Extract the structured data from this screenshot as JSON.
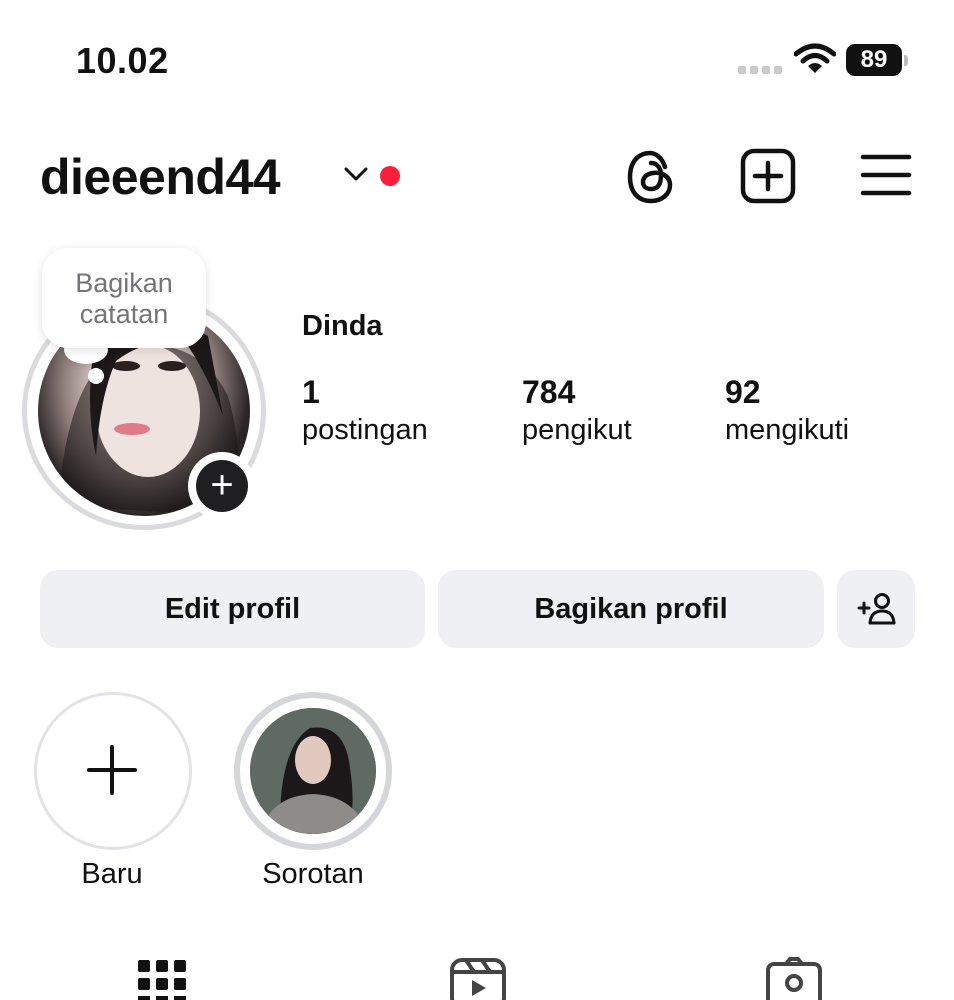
{
  "status_bar": {
    "time": "10.02",
    "battery": "89"
  },
  "header": {
    "username": "dieeend44",
    "icons": [
      "chevron-down-icon",
      "notification-dot",
      "threads-icon",
      "add-post-icon",
      "menu-icon"
    ]
  },
  "profile": {
    "note_text_line1": "Bagikan",
    "note_text_line2": "catatan",
    "display_name": "Dinda",
    "stats": [
      {
        "value": "1",
        "label": "postingan"
      },
      {
        "value": "784",
        "label": "pengikut"
      },
      {
        "value": "92",
        "label": "mengikuti"
      }
    ]
  },
  "actions": {
    "edit_label": "Edit profil",
    "share_label": "Bagikan profil",
    "add_person_icon": "add-person-icon"
  },
  "highlights": [
    {
      "label": "Baru"
    },
    {
      "label": "Sorotan"
    }
  ],
  "tabs": [
    "grid-icon",
    "reels-icon",
    "tagged-icon"
  ],
  "colors": {
    "accent_red": "#ff1f3d",
    "button_bg": "#eff0f4",
    "ring": "#dbdbdf"
  }
}
